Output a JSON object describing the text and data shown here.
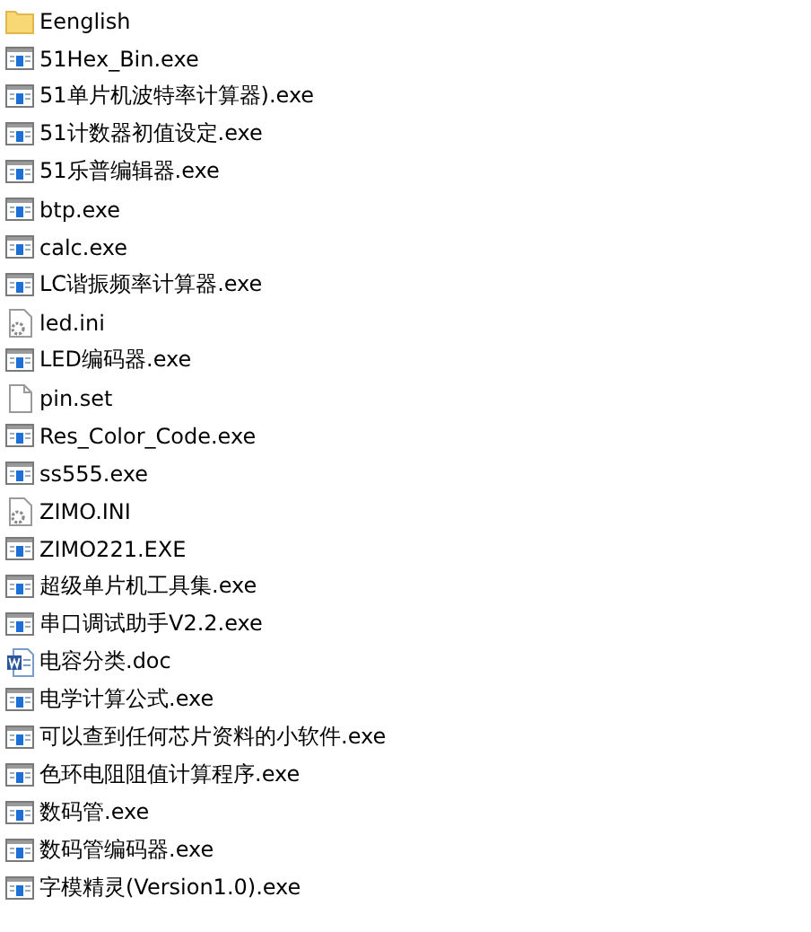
{
  "files": [
    {
      "name": "Eenglish",
      "kind": "folder"
    },
    {
      "name": "51Hex_Bin.exe",
      "kind": "exe"
    },
    {
      "name": "51单片机波特率计算器).exe",
      "kind": "exe"
    },
    {
      "name": "51计数器初值设定.exe",
      "kind": "exe"
    },
    {
      "name": "51乐普编辑器.exe",
      "kind": "exe"
    },
    {
      "name": "btp.exe",
      "kind": "exe"
    },
    {
      "name": "calc.exe",
      "kind": "exe"
    },
    {
      "name": "LC谐振频率计算器.exe",
      "kind": "exe"
    },
    {
      "name": "led.ini",
      "kind": "ini"
    },
    {
      "name": "LED编码器.exe",
      "kind": "exe"
    },
    {
      "name": "pin.set",
      "kind": "file"
    },
    {
      "name": "Res_Color_Code.exe",
      "kind": "exe"
    },
    {
      "name": "ss555.exe",
      "kind": "exe"
    },
    {
      "name": "ZIMO.INI",
      "kind": "ini"
    },
    {
      "name": "ZIMO221.EXE",
      "kind": "exe"
    },
    {
      "name": "超级单片机工具集.exe",
      "kind": "exe"
    },
    {
      "name": "串口调试助手V2.2.exe",
      "kind": "exe"
    },
    {
      "name": "电容分类.doc",
      "kind": "doc"
    },
    {
      "name": "电学计算公式.exe",
      "kind": "exe"
    },
    {
      "name": "可以查到任何芯片资料的小软件.exe",
      "kind": "exe"
    },
    {
      "name": "色环电阻阻值计算程序.exe",
      "kind": "exe"
    },
    {
      "name": "数码管.exe",
      "kind": "exe"
    },
    {
      "name": "数码管编码器.exe",
      "kind": "exe"
    },
    {
      "name": "字模精灵(Version1.0).exe",
      "kind": "exe"
    }
  ]
}
